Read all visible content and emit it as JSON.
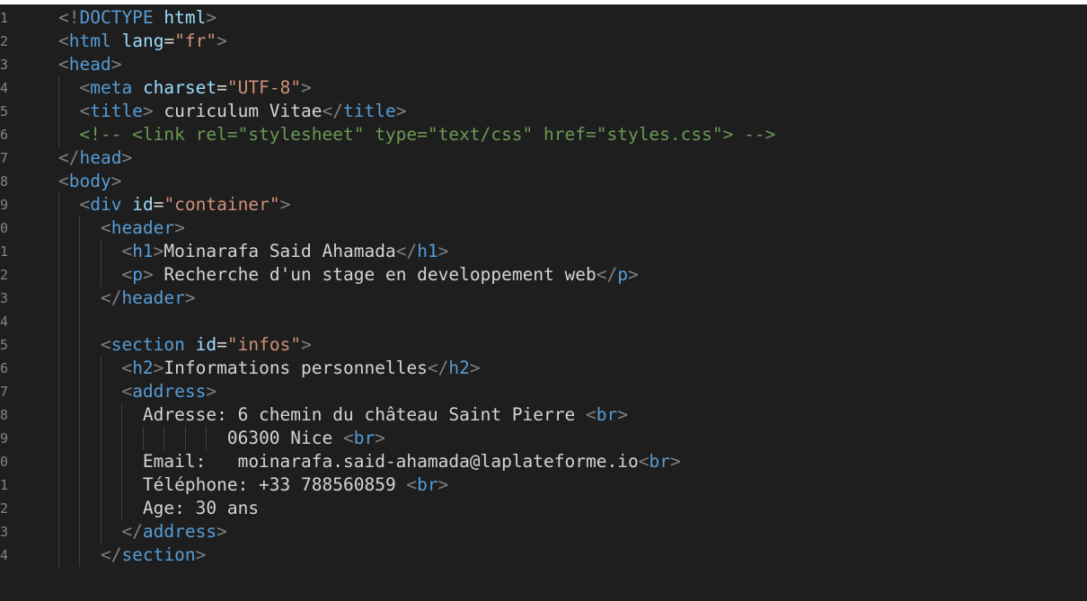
{
  "editor": {
    "line_numbers": [
      "1",
      "2",
      "3",
      "4",
      "5",
      "6",
      "7",
      "8",
      "9",
      "0",
      "1",
      "2",
      "3",
      "4",
      "5",
      "6",
      "7",
      "8",
      "9",
      "0",
      "1",
      "2",
      "3",
      "4"
    ],
    "lines": [
      {
        "indent": 0,
        "tokens": [
          {
            "k": "tb",
            "s": "<!"
          },
          {
            "k": "t",
            "s": "DOCTYPE"
          },
          {
            "k": "x",
            "s": " "
          },
          {
            "k": "a",
            "s": "html"
          },
          {
            "k": "tb",
            "s": ">"
          }
        ]
      },
      {
        "indent": 0,
        "tokens": [
          {
            "k": "tb",
            "s": "<"
          },
          {
            "k": "t",
            "s": "html"
          },
          {
            "k": "x",
            "s": " "
          },
          {
            "k": "a",
            "s": "lang"
          },
          {
            "k": "x",
            "s": "="
          },
          {
            "k": "v",
            "s": "\"fr\""
          },
          {
            "k": "tb",
            "s": ">"
          }
        ]
      },
      {
        "indent": 0,
        "tokens": [
          {
            "k": "tb",
            "s": "<"
          },
          {
            "k": "t",
            "s": "head"
          },
          {
            "k": "tb",
            "s": ">"
          }
        ]
      },
      {
        "indent": 1,
        "tokens": [
          {
            "k": "tb",
            "s": "<"
          },
          {
            "k": "t",
            "s": "meta"
          },
          {
            "k": "x",
            "s": " "
          },
          {
            "k": "a",
            "s": "charset"
          },
          {
            "k": "x",
            "s": "="
          },
          {
            "k": "v",
            "s": "\"UTF-8\""
          },
          {
            "k": "tb",
            "s": ">"
          }
        ]
      },
      {
        "indent": 1,
        "tokens": [
          {
            "k": "tb",
            "s": "<"
          },
          {
            "k": "t",
            "s": "title"
          },
          {
            "k": "tb",
            "s": ">"
          },
          {
            "k": "x",
            "s": " curiculum Vitae"
          },
          {
            "k": "tb",
            "s": "</"
          },
          {
            "k": "t",
            "s": "title"
          },
          {
            "k": "tb",
            "s": ">"
          }
        ]
      },
      {
        "indent": 1,
        "tokens": [
          {
            "k": "c",
            "s": "<!-- <link rel=\"stylesheet\" type=\"text/css\" href=\"styles.css\"> -->"
          }
        ]
      },
      {
        "indent": 0,
        "tokens": [
          {
            "k": "tb",
            "s": "</"
          },
          {
            "k": "t",
            "s": "head"
          },
          {
            "k": "tb",
            "s": ">"
          }
        ]
      },
      {
        "indent": 0,
        "tokens": [
          {
            "k": "tb",
            "s": "<"
          },
          {
            "k": "t",
            "s": "body"
          },
          {
            "k": "tb",
            "s": ">"
          }
        ]
      },
      {
        "indent": 1,
        "tokens": [
          {
            "k": "tb",
            "s": "<"
          },
          {
            "k": "t",
            "s": "div"
          },
          {
            "k": "x",
            "s": " "
          },
          {
            "k": "a",
            "s": "id"
          },
          {
            "k": "x",
            "s": "="
          },
          {
            "k": "v",
            "s": "\"container\""
          },
          {
            "k": "tb",
            "s": ">"
          }
        ]
      },
      {
        "indent": 2,
        "tokens": [
          {
            "k": "tb",
            "s": "<"
          },
          {
            "k": "t",
            "s": "header"
          },
          {
            "k": "tb",
            "s": ">"
          }
        ]
      },
      {
        "indent": 3,
        "tokens": [
          {
            "k": "tb",
            "s": "<"
          },
          {
            "k": "t",
            "s": "h1"
          },
          {
            "k": "tb",
            "s": ">"
          },
          {
            "k": "x",
            "s": "Moinarafa Said Ahamada"
          },
          {
            "k": "tb",
            "s": "</"
          },
          {
            "k": "t",
            "s": "h1"
          },
          {
            "k": "tb",
            "s": ">"
          }
        ]
      },
      {
        "indent": 3,
        "tokens": [
          {
            "k": "tb",
            "s": "<"
          },
          {
            "k": "t",
            "s": "p"
          },
          {
            "k": "tb",
            "s": ">"
          },
          {
            "k": "x",
            "s": " Recherche d'un stage en developpement web"
          },
          {
            "k": "tb",
            "s": "</"
          },
          {
            "k": "t",
            "s": "p"
          },
          {
            "k": "tb",
            "s": ">"
          }
        ]
      },
      {
        "indent": 2,
        "tokens": [
          {
            "k": "tb",
            "s": "</"
          },
          {
            "k": "t",
            "s": "header"
          },
          {
            "k": "tb",
            "s": ">"
          }
        ]
      },
      {
        "indent": 0,
        "tokens": []
      },
      {
        "indent": 2,
        "tokens": [
          {
            "k": "tb",
            "s": "<"
          },
          {
            "k": "t",
            "s": "section"
          },
          {
            "k": "x",
            "s": " "
          },
          {
            "k": "a",
            "s": "id"
          },
          {
            "k": "x",
            "s": "="
          },
          {
            "k": "v",
            "s": "\"infos\""
          },
          {
            "k": "tb",
            "s": ">"
          }
        ]
      },
      {
        "indent": 3,
        "tokens": [
          {
            "k": "tb",
            "s": "<"
          },
          {
            "k": "t",
            "s": "h2"
          },
          {
            "k": "tb",
            "s": ">"
          },
          {
            "k": "x",
            "s": "Informations personnelles"
          },
          {
            "k": "tb",
            "s": "</"
          },
          {
            "k": "t",
            "s": "h2"
          },
          {
            "k": "tb",
            "s": ">"
          }
        ]
      },
      {
        "indent": 3,
        "tokens": [
          {
            "k": "tb",
            "s": "<"
          },
          {
            "k": "t",
            "s": "address"
          },
          {
            "k": "tb",
            "s": ">"
          }
        ]
      },
      {
        "indent": 4,
        "tokens": [
          {
            "k": "x",
            "s": "Adresse: 6 chemin du château Saint Pierre "
          },
          {
            "k": "tb",
            "s": "<"
          },
          {
            "k": "t",
            "s": "br"
          },
          {
            "k": "tb",
            "s": ">"
          }
        ]
      },
      {
        "indent": 8,
        "tokens": [
          {
            "k": "x",
            "s": "06300 Nice "
          },
          {
            "k": "tb",
            "s": "<"
          },
          {
            "k": "t",
            "s": "br"
          },
          {
            "k": "tb",
            "s": ">"
          }
        ]
      },
      {
        "indent": 4,
        "tokens": [
          {
            "k": "x",
            "s": "Email:   moinarafa.said-ahamada@laplateforme.io"
          },
          {
            "k": "tb",
            "s": "<"
          },
          {
            "k": "t",
            "s": "br"
          },
          {
            "k": "tb",
            "s": ">"
          }
        ]
      },
      {
        "indent": 4,
        "tokens": [
          {
            "k": "x",
            "s": "Téléphone: +33 788560859 "
          },
          {
            "k": "tb",
            "s": "<"
          },
          {
            "k": "t",
            "s": "br"
          },
          {
            "k": "tb",
            "s": ">"
          }
        ]
      },
      {
        "indent": 4,
        "tokens": [
          {
            "k": "x",
            "s": "Age: 30 ans"
          }
        ]
      },
      {
        "indent": 3,
        "tokens": [
          {
            "k": "tb",
            "s": "</"
          },
          {
            "k": "t",
            "s": "address"
          },
          {
            "k": "tb",
            "s": ">"
          }
        ]
      },
      {
        "indent": 2,
        "tokens": [
          {
            "k": "tb",
            "s": "</"
          },
          {
            "k": "t",
            "s": "section"
          },
          {
            "k": "tb",
            "s": ">"
          }
        ]
      }
    ]
  }
}
